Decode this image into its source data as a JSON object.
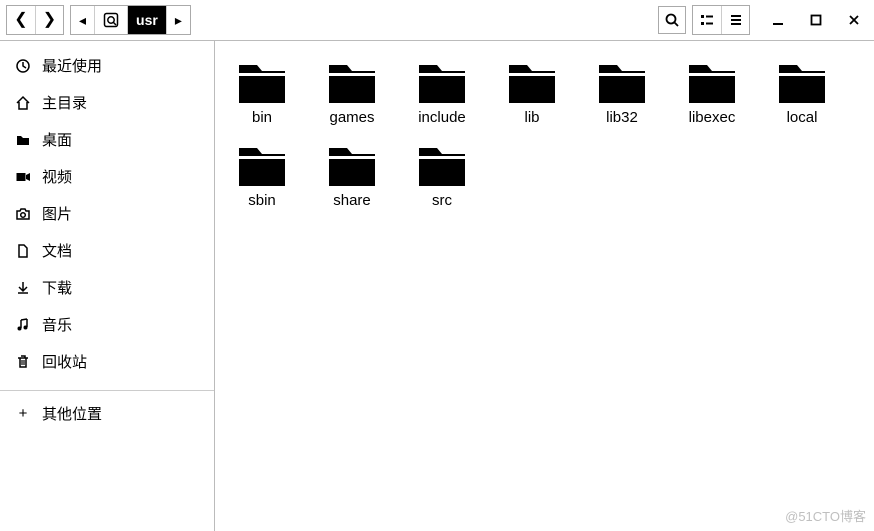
{
  "path": {
    "root_aria": "root",
    "current": "usr",
    "forward_aria": "forward"
  },
  "sidebar": {
    "items": [
      {
        "label": "最近使用",
        "icon": "clock-icon"
      },
      {
        "label": "主目录",
        "icon": "home-icon"
      },
      {
        "label": "桌面",
        "icon": "folder-small-icon"
      },
      {
        "label": "视频",
        "icon": "video-icon"
      },
      {
        "label": "图片",
        "icon": "camera-icon"
      },
      {
        "label": "文档",
        "icon": "document-icon"
      },
      {
        "label": "下载",
        "icon": "download-icon"
      },
      {
        "label": "音乐",
        "icon": "music-icon"
      },
      {
        "label": "回收站",
        "icon": "trash-icon"
      }
    ],
    "other": {
      "label": "其他位置",
      "icon": "plus-icon"
    }
  },
  "folders": [
    {
      "name": "bin"
    },
    {
      "name": "games"
    },
    {
      "name": "include"
    },
    {
      "name": "lib"
    },
    {
      "name": "lib32"
    },
    {
      "name": "libexec"
    },
    {
      "name": "local"
    },
    {
      "name": "sbin"
    },
    {
      "name": "share"
    },
    {
      "name": "src"
    }
  ],
  "watermark": "@51CTO博客"
}
